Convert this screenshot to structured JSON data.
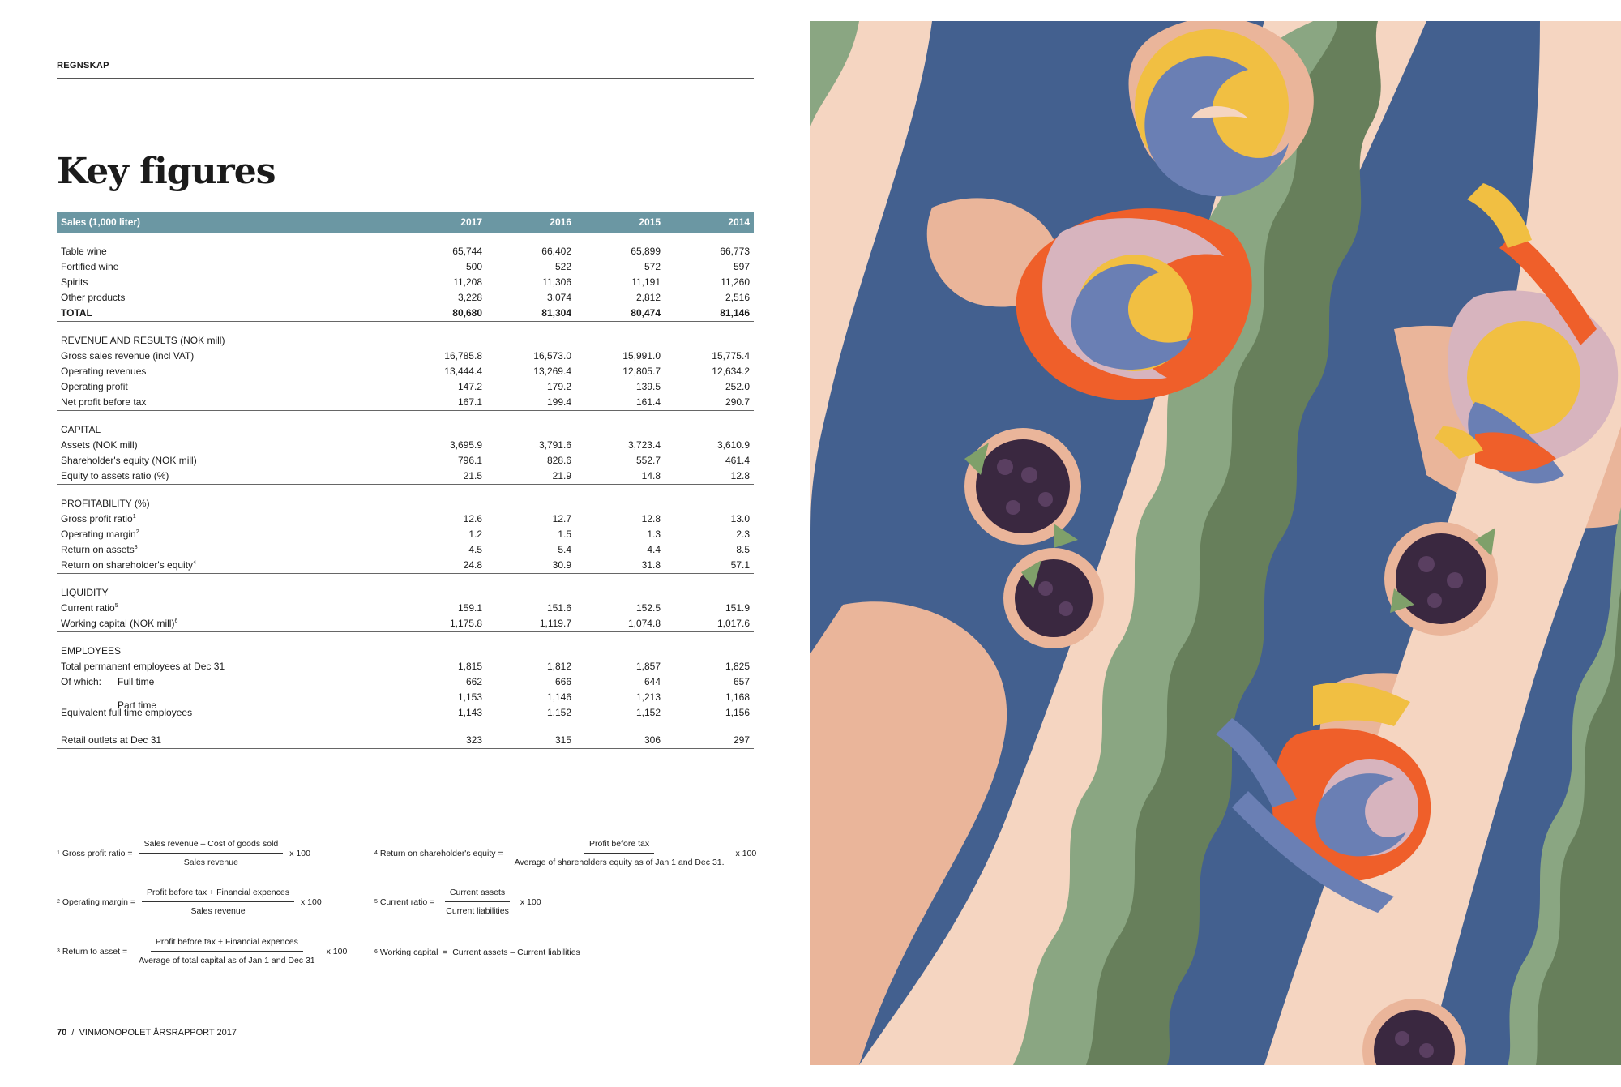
{
  "header": {
    "section": "REGNSKAP",
    "title": "Key figures"
  },
  "table": {
    "header": [
      "Sales (1,000 liter)",
      "2017",
      "2016",
      "2015",
      "2014"
    ],
    "sales": [
      {
        "label": "Table wine",
        "values": [
          "65,744",
          "66,402",
          "65,899",
          "66,773"
        ]
      },
      {
        "label": "Fortified wine",
        "values": [
          "500",
          "522",
          "572",
          "597"
        ]
      },
      {
        "label": "Spirits",
        "values": [
          "11,208",
          "11,306",
          "11,191",
          "11,260"
        ]
      },
      {
        "label": "Other products",
        "values": [
          "3,228",
          "3,074",
          "2,812",
          "2,516"
        ]
      },
      {
        "label": "TOTAL",
        "values": [
          "80,680",
          "81,304",
          "80,474",
          "81,146"
        ]
      }
    ],
    "revenue_title": "REVENUE AND RESULTS (NOK mill)",
    "revenue": [
      {
        "label": "Gross sales revenue (incl VAT)",
        "values": [
          "16,785.8",
          "16,573.0",
          "15,991.0",
          "15,775.4"
        ]
      },
      {
        "label": "Operating revenues",
        "values": [
          "13,444.4",
          "13,269.4",
          "12,805.7",
          "12,634.2"
        ]
      },
      {
        "label": "Operating profit",
        "values": [
          "147.2",
          "179.2",
          "139.5",
          "252.0"
        ]
      },
      {
        "label": "Net profit before tax",
        "values": [
          "167.1",
          "199.4",
          "161.4",
          "290.7"
        ]
      }
    ],
    "capital_title": "CAPITAL",
    "capital": [
      {
        "label": "Assets (NOK mill)",
        "values": [
          "3,695.9",
          "3,791.6",
          "3,723.4",
          "3,610.9"
        ]
      },
      {
        "label": "Shareholder's equity (NOK mill)",
        "values": [
          "796.1",
          "828.6",
          "552.7",
          "461.4"
        ]
      },
      {
        "label": "Equity to assets ratio (%)",
        "values": [
          "21.5",
          "21.9",
          "14.8",
          "12.8"
        ]
      }
    ],
    "profitability_title": "PROFITABILITY (%)",
    "profitability": [
      {
        "label": "Gross profit ratio",
        "sup": "1",
        "values": [
          "12.6",
          "12.7",
          "12.8",
          "13.0"
        ]
      },
      {
        "label": "Operating margin",
        "sup": "2",
        "values": [
          "1.2",
          "1.5",
          "1.3",
          "2.3"
        ]
      },
      {
        "label": "Return on assets",
        "sup": "3",
        "values": [
          "4.5",
          "5.4",
          "4.4",
          "8.5"
        ]
      },
      {
        "label": "Return on shareholder's equity",
        "sup": "4",
        "values": [
          "24.8",
          "30.9",
          "31.8",
          "57.1"
        ]
      }
    ],
    "liquidity_title": "LIQUIDITY",
    "liquidity": [
      {
        "label": "Current ratio",
        "sup": "5",
        "values": [
          "159.1",
          "151.6",
          "152.5",
          "151.9"
        ]
      },
      {
        "label": "Working capital (NOK mill)",
        "sup": "6",
        "values": [
          "1,175.8",
          "1,119.7",
          "1,074.8",
          "1,017.6"
        ]
      }
    ],
    "employees_title": "EMPLOYEES",
    "employees": [
      {
        "label": "Total permanent employees at Dec 31",
        "values": [
          "1,815",
          "1,812",
          "1,857",
          "1,825"
        ]
      },
      {
        "label": "Of which:",
        "sub": "Full time",
        "values": [
          "662",
          "666",
          "644",
          "657"
        ]
      },
      {
        "label": "",
        "sub": "Part time",
        "values": [
          "1,153",
          "1,146",
          "1,213",
          "1,168"
        ]
      },
      {
        "label": "Equivalent full time employees",
        "values": [
          "1,143",
          "1,152",
          "1,152",
          "1,156"
        ]
      }
    ],
    "retail": {
      "label": "Retail outlets at Dec 31",
      "values": [
        "323",
        "315",
        "306",
        "297"
      ]
    }
  },
  "footnotes": {
    "f1": {
      "mark": "1",
      "label": "Gross profit ratio =",
      "num": "Sales revenue – Cost of goods sold",
      "den": "Sales revenue",
      "tail": "x 100"
    },
    "f2": {
      "mark": "2",
      "label": "Operating margin =",
      "num": "Profit before tax + Financial expences",
      "den": "Sales revenue",
      "tail": "x 100"
    },
    "f3": {
      "mark": "3",
      "label": "Return to asset =",
      "num": "Profit before tax + Financial expences",
      "den": "Average of total capital as of Jan 1 and Dec 31",
      "tail": "x 100"
    },
    "f4": {
      "mark": "4",
      "label": "Return on shareholder's equity =",
      "num": "Profit before tax",
      "den": "Average of shareholders equity as of Jan 1 and Dec 31.",
      "tail": "x 100"
    },
    "f5": {
      "mark": "5",
      "label": "Current ratio =",
      "num": "Current assets",
      "den": "Current liabilities",
      "tail": "x 100"
    },
    "f6": {
      "mark": "6",
      "label": "Working capital  =  Current assets – Current liabilities"
    }
  },
  "footer": {
    "page": "70",
    "sep": "/",
    "publication": "VINMONOPOLET ÅRSRAPPORT 2017"
  },
  "illustration": {
    "colors": {
      "blue": "#43608f",
      "pink": "#f5d5c1",
      "peach": "#eab59a",
      "sage": "#8aa682",
      "green": "#677f5b",
      "yellow": "#f1bf42",
      "orange": "#ef5f2a",
      "lavender": "#d7b4be",
      "periwinkle": "#6a7fb4",
      "grape": "#3a2840",
      "leaf": "#7fa06a"
    }
  }
}
